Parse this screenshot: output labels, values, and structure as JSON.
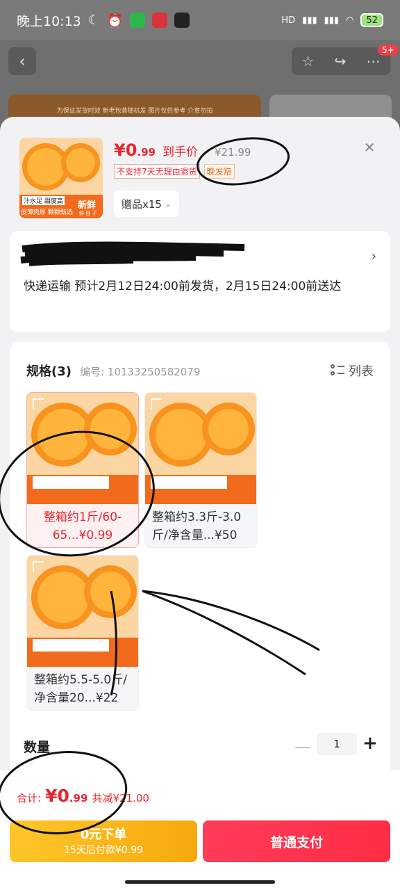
{
  "status_bar": {
    "time": "晚上10:13",
    "battery": "52",
    "signal": "HD"
  },
  "background": {
    "badge": "5+",
    "banner_text": "为保证发货时效 新老包装随机发 图片仅供参考 介意勿拍"
  },
  "product": {
    "price_int": "¥0",
    "price_dec": ".99",
    "price_label": "到手价",
    "original_price": "¥21.99",
    "tags": [
      "不支持7天无理由退货",
      "晚发赔"
    ],
    "gift_label": "赠品x15",
    "thumb_text_1": "汁水足 甜度高",
    "thumb_text_2": "皮薄肉厚 颗颗甄选",
    "thumb_fresh": "新鲜",
    "thumb_small": "鲜 橙 子"
  },
  "address": {
    "shipping": "快递运输 预计2月12日24:00前发货，2月15日24:00前送达"
  },
  "specs": {
    "title": "规格(3)",
    "number": "编号: 10133250582079",
    "list_label": "列表",
    "variants": [
      {
        "label": "整箱约1斤/60-65...¥0.99",
        "selected": true
      },
      {
        "label": "整箱约3.3斤-3.0斤/净含量...¥50",
        "selected": false
      },
      {
        "label": "整箱约5.5-5.0斤/净含量20...¥22",
        "selected": false
      }
    ]
  },
  "quantity": {
    "label": "数量",
    "value": "1"
  },
  "footer": {
    "total_label": "合计:",
    "total_int": "¥0",
    "total_dec": ".99",
    "discount": "共减¥21.00",
    "later_line1": "0元下单",
    "later_line2": "15天后付款¥0.99",
    "pay_label": "普通支付"
  },
  "colors": {
    "accent_red": "#e8262f",
    "pay_red": "#ff2d43",
    "later_yellow": "#f6a90f"
  }
}
